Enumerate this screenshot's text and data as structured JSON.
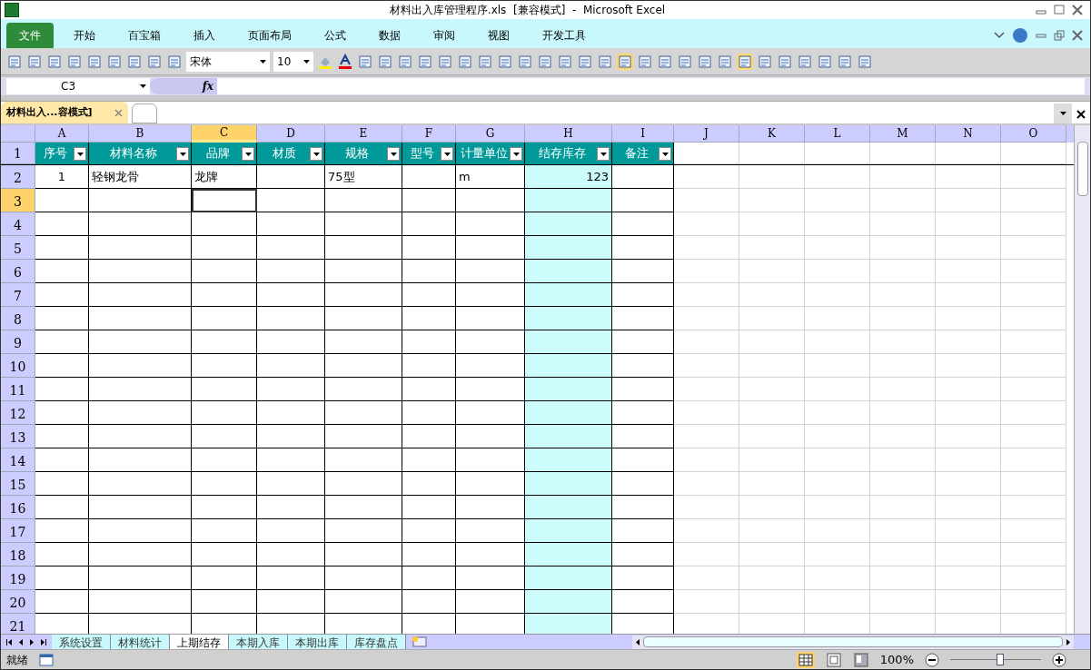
{
  "window": {
    "title": "材料出入库管理程序.xls  [兼容模式]  -  Microsoft Excel"
  },
  "ribbon_tabs": [
    {
      "label": "文件",
      "selected": true
    },
    {
      "label": "开始",
      "selected": false
    },
    {
      "label": "百宝箱",
      "selected": false
    },
    {
      "label": "插入",
      "selected": false
    },
    {
      "label": "页面布局",
      "selected": false
    },
    {
      "label": "公式",
      "selected": false
    },
    {
      "label": "数据",
      "selected": false
    },
    {
      "label": "审阅",
      "selected": false
    },
    {
      "label": "视图",
      "selected": false
    },
    {
      "label": "开发工具",
      "selected": false
    }
  ],
  "toolbar": {
    "font": "宋体",
    "font_size": "10"
  },
  "formula_bar": {
    "name_box": "C3",
    "fx": "fx"
  },
  "workbook_tab": {
    "label": "材料出入...容模式]",
    "selected": true
  },
  "columns": [
    {
      "letter": "A",
      "selected": false,
      "highlighted": false
    },
    {
      "letter": "B",
      "selected": false,
      "highlighted": false
    },
    {
      "letter": "C",
      "selected": true,
      "highlighted": false
    },
    {
      "letter": "D",
      "selected": false,
      "highlighted": false
    },
    {
      "letter": "E",
      "selected": false,
      "highlighted": false
    },
    {
      "letter": "F",
      "selected": false,
      "highlighted": false
    },
    {
      "letter": "G",
      "selected": false,
      "highlighted": false
    },
    {
      "letter": "H",
      "selected": false,
      "highlighted": true
    },
    {
      "letter": "I",
      "selected": false,
      "highlighted": false
    },
    {
      "letter": "J",
      "selected": false,
      "highlighted": false
    },
    {
      "letter": "K",
      "selected": false,
      "highlighted": false
    },
    {
      "letter": "L",
      "selected": false,
      "highlighted": false
    },
    {
      "letter": "M",
      "selected": false,
      "highlighted": false
    },
    {
      "letter": "N",
      "selected": false,
      "highlighted": false
    },
    {
      "letter": "O",
      "selected": false,
      "highlighted": false
    }
  ],
  "header_row": [
    "序号",
    "材料名称",
    "品牌",
    "材质",
    "规格",
    "型号",
    "计量单位",
    "结存库存",
    "备注"
  ],
  "records": [
    {
      "A": "1",
      "B": "轻钢龙骨",
      "C": "龙牌",
      "E": "75型",
      "G": "m",
      "H": "123"
    }
  ],
  "row_numbers": [
    {
      "label": "1",
      "selected": false
    },
    {
      "label": "2",
      "selected": false
    },
    {
      "label": "3",
      "selected": true
    },
    {
      "label": "4",
      "selected": false
    },
    {
      "label": "5",
      "selected": false
    },
    {
      "label": "6",
      "selected": false
    },
    {
      "label": "7",
      "selected": false
    },
    {
      "label": "8",
      "selected": false
    },
    {
      "label": "9",
      "selected": false
    },
    {
      "label": "10",
      "selected": false
    },
    {
      "label": "11",
      "selected": false
    },
    {
      "label": "12",
      "selected": false
    },
    {
      "label": "13",
      "selected": false
    },
    {
      "label": "14",
      "selected": false
    },
    {
      "label": "15",
      "selected": false
    },
    {
      "label": "16",
      "selected": false
    },
    {
      "label": "17",
      "selected": false
    },
    {
      "label": "18",
      "selected": false
    },
    {
      "label": "19",
      "selected": false
    },
    {
      "label": "20",
      "selected": false
    },
    {
      "label": "21",
      "selected": false
    }
  ],
  "sheet_tabs": [
    {
      "label": "系统设置",
      "selected": false
    },
    {
      "label": "材料统计",
      "selected": false
    },
    {
      "label": "上期结存",
      "selected": true
    },
    {
      "label": "本期入库",
      "selected": false
    },
    {
      "label": "本期出库",
      "selected": false
    },
    {
      "label": "库存盘点",
      "selected": false
    }
  ],
  "status_bar": {
    "status": "就绪",
    "zoom": "100%",
    "zoom_slider": {
      "level": 0.55
    }
  }
}
